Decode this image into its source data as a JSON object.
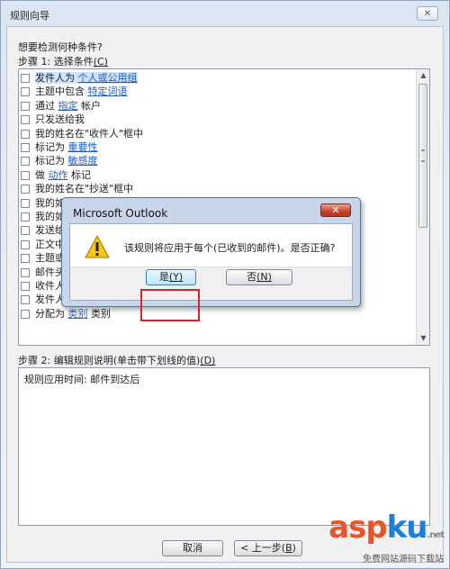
{
  "wizard": {
    "title": "规则向导",
    "close_glyph": "✕",
    "question": "想要检测何种条件?",
    "step1_label": "步骤 1: 选择条件",
    "step1_accel": "(C)",
    "conditions": [
      {
        "pre": "发件人为 ",
        "link": "个人或公用组",
        "post": ""
      },
      {
        "pre": "主题中包含 ",
        "link": "特定词语",
        "post": ""
      },
      {
        "pre": "通过 ",
        "link": "指定",
        "post": " 帐户"
      },
      {
        "pre": "只发送给我",
        "link": "",
        "post": ""
      },
      {
        "pre": "我的姓名在\"收件人\"框中",
        "link": "",
        "post": ""
      },
      {
        "pre": "标记为 ",
        "link": "重要性",
        "post": ""
      },
      {
        "pre": "标记为 ",
        "link": "敏感度",
        "post": ""
      },
      {
        "pre": "做 ",
        "link": "动作",
        "post": " 标记"
      },
      {
        "pre": "我的姓名在\"抄送\"框中",
        "link": "",
        "post": ""
      },
      {
        "pre": "我的如",
        "link": "",
        "post": ""
      },
      {
        "pre": "我的如",
        "link": "",
        "post": ""
      },
      {
        "pre": "发送给",
        "link": "",
        "post": ""
      },
      {
        "pre": "正文中",
        "link": "",
        "post": ""
      },
      {
        "pre": "主题或",
        "link": "",
        "post": ""
      },
      {
        "pre": "邮件头",
        "link": "",
        "post": ""
      },
      {
        "pre": "收件人",
        "link": "",
        "post": ""
      },
      {
        "pre": "发件人",
        "link": "",
        "post": ""
      },
      {
        "pre": "分配为 ",
        "link": "类别",
        "post": " 类别"
      }
    ],
    "step2_label": "步骤 2: 编辑规则说明(单击带下划线的值)",
    "step2_accel": "(D)",
    "description": "规则应用时间: 邮件到达后",
    "buttons": {
      "cancel": "取消",
      "back_pre": "< 上一步(",
      "back_key": "B",
      "back_post": ")"
    }
  },
  "dialog": {
    "title": "Microsoft Outlook",
    "close_glyph": "✕",
    "message": "该规则将应用于每个(已收到的邮件)。是否正确?",
    "yes_label": "是",
    "yes_key": "(Y)",
    "no_label": "否",
    "no_key": "(N)",
    "icon": "warning-icon"
  },
  "watermark": {
    "logo_a": "a",
    "logo_s": "s",
    "logo_p": "p",
    "logo_k": "k",
    "logo_u": "u",
    "net": ".net",
    "sub": "免费网站源码下载站"
  },
  "colors": {
    "link": "#1d5ec8",
    "highlight": "#d8232a",
    "selection": "#cfe3fb"
  }
}
